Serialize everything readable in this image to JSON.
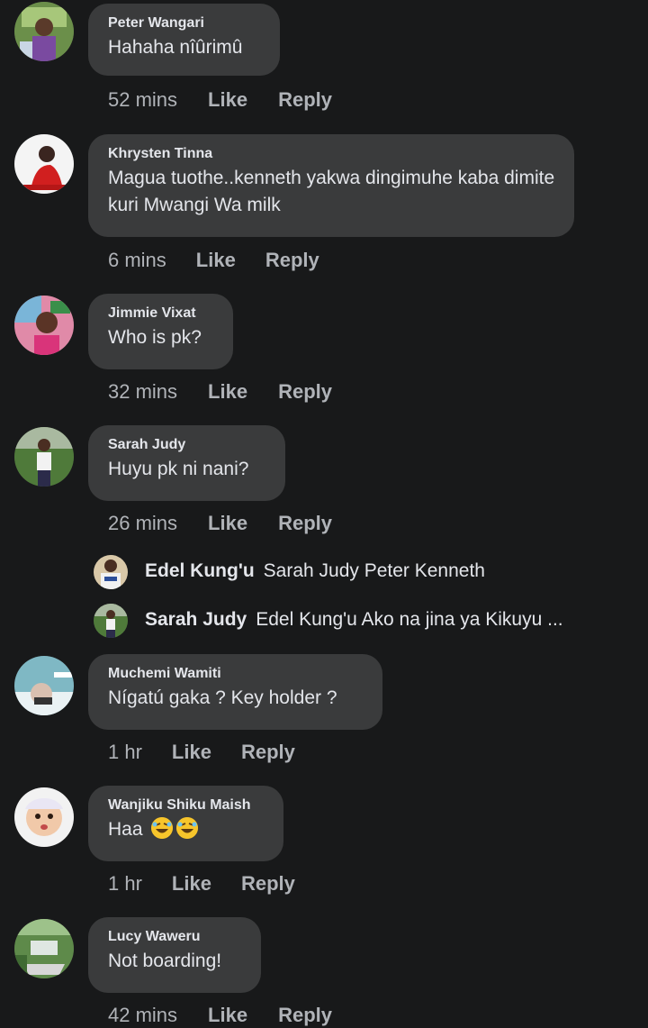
{
  "comments": [
    {
      "author": "Peter Wangari",
      "text": "Hahaha nîûrimû",
      "time": "52 mins",
      "like": "Like",
      "reply": "Reply",
      "avatar": "person-avatar"
    },
    {
      "author": "Khrysten Tinna",
      "text": "Magua tuothe..kenneth yakwa dingimuhe kaba dimite kuri Mwangi Wa milk",
      "time": "6 mins",
      "like": "Like",
      "reply": "Reply",
      "avatar": "person-avatar"
    },
    {
      "author": "Jimmie Vixat",
      "text": "Who is pk?",
      "time": "32 mins",
      "like": "Like",
      "reply": "Reply",
      "avatar": "person-avatar"
    },
    {
      "author": "Sarah Judy",
      "text": "Huyu pk ni nani?",
      "time": "26 mins",
      "like": "Like",
      "reply": "Reply",
      "avatar": "person-avatar"
    },
    {
      "author": "Muchemi Wamiti",
      "text": "Nígatú gaka ? Key holder ?",
      "time": "1 hr",
      "like": "Like",
      "reply": "Reply",
      "avatar": "person-avatar"
    },
    {
      "author": "Wanjiku Shiku Maish",
      "text": "Haa",
      "emoji": "rolling-on-floor-laughing-emoji",
      "time": "1 hr",
      "like": "Like",
      "reply": "Reply",
      "avatar": "baby-avatar"
    },
    {
      "author": "Lucy Waweru",
      "text": "Not boarding!",
      "time": "42 mins",
      "like": "Like",
      "reply": "Reply",
      "avatar": "landscape-avatar"
    }
  ],
  "replies": [
    {
      "author": "Edel Kung'u",
      "text": "Sarah Judy Peter Kenneth"
    },
    {
      "author": "Sarah Judy",
      "text": "Edel Kung'u Ako na jina ya Kikuyu ..."
    }
  ],
  "colors": {
    "background": "#18191a",
    "bubble": "#3a3b3c",
    "text": "#e4e6eb",
    "secondary": "#b0b3b8"
  }
}
